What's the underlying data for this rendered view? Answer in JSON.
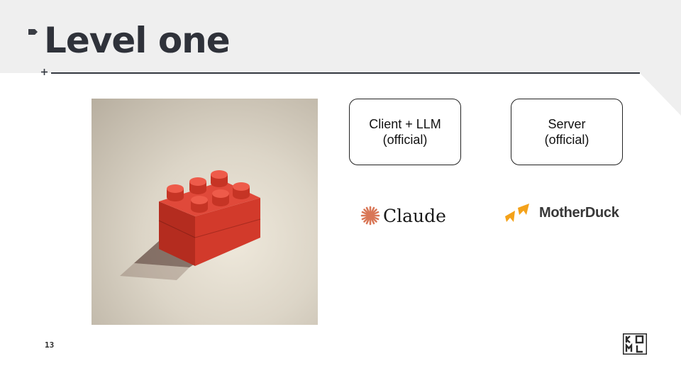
{
  "slide": {
    "title": "Level one",
    "page_number": "13"
  },
  "boxes": {
    "client": {
      "line1": "Client + LLM",
      "line2": "(official)"
    },
    "server": {
      "line1": "Server",
      "line2": "(official)"
    }
  },
  "logos": {
    "claude": {
      "text": "Claude",
      "color": "#d97757"
    },
    "motherduck": {
      "text": "MotherDuck",
      "color": "#f4a21a"
    },
    "corner": {
      "text": "KOML"
    }
  },
  "photo": {
    "subject": "red-lego-brick"
  },
  "colors": {
    "header_band": "#efefef",
    "title": "#2f323a",
    "brick": "#d23a2b"
  }
}
